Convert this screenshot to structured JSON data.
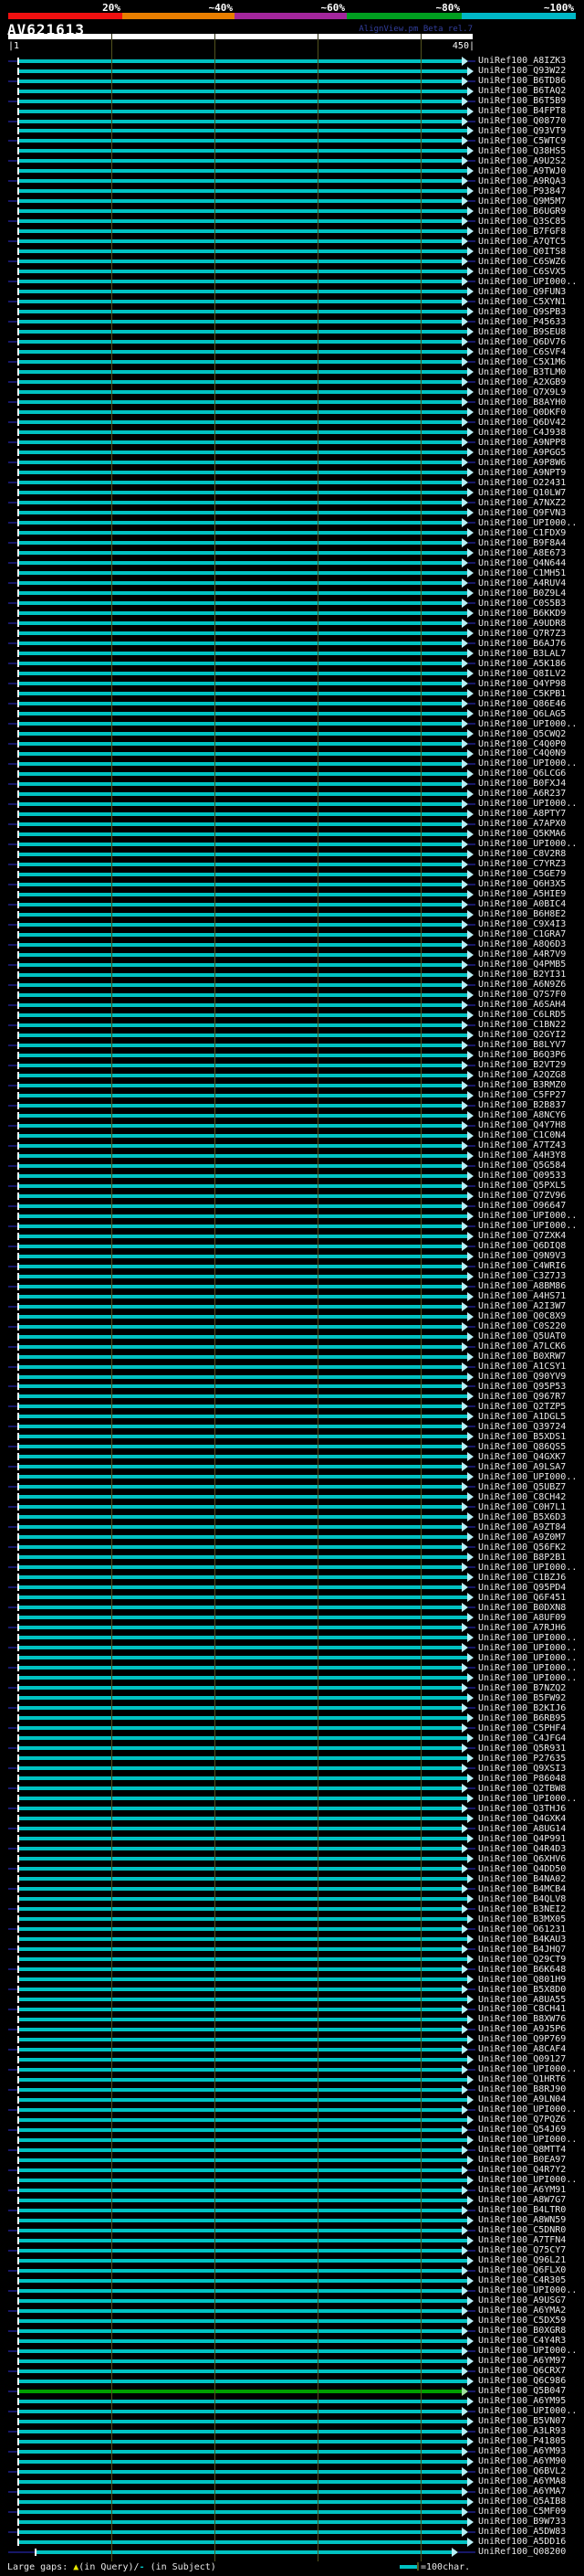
{
  "scale_bar": {
    "labels": [
      "20%",
      "~40%",
      "~60%",
      "~80%",
      "~100%"
    ],
    "colors": [
      "#f01010",
      "#e87e00",
      "#a3269c",
      "#009f20",
      "#00b7c6"
    ]
  },
  "header": {
    "query_title": "AV621613",
    "watermark": "AlignView.pm Beta rel.7",
    "ruler_start_label": "|1",
    "ruler_end_label": "450|"
  },
  "footer": {
    "gaps_prefix": "Large gaps: ",
    "gap_query_symbol": "▲",
    "gaps_mid": "(in Query)/",
    "gap_subject_symbol": "-",
    "gaps_suffix": " (in Subject)",
    "legend_label": "=100char."
  },
  "colors": {
    "alignment": "#00c2c2",
    "alignment_80pct": "#00a000",
    "subject_line": "#171768",
    "gridline": "#52521d",
    "arrow": "#b8eef5",
    "arrow_80pct": "#9fe0a0",
    "start_tick": "#ffffff",
    "label_text": "#e8e8e8"
  },
  "chart_data": {
    "type": "bar",
    "orientation": "horizontal",
    "query": "AV621613",
    "query_length": 450,
    "x_range": [
      1,
      450
    ],
    "grid_positions": [
      100,
      200,
      300,
      400
    ],
    "legend_unit": "=100char.",
    "identity_bins": [
      "20%",
      "~40%",
      "~60%",
      "~80%",
      "~100%"
    ],
    "hit_span_default": [
      1,
      450
    ],
    "hit_identity_default": "~100%",
    "hit_exceptions": {
      "232": {
        "identity_bin": "~80%"
      },
      "248": {
        "span": [
          18,
          430
        ]
      }
    },
    "hit_labels": [
      "UniRef100_A8IZK3",
      "UniRef100_Q93W22",
      "UniRef100_B6TD86",
      "UniRef100_B6TAQ2",
      "UniRef100_B6T5B9",
      "UniRef100_B4FPT8",
      "UniRef100_Q08770",
      "UniRef100_Q93VT9",
      "UniRef100_C5WTC9",
      "UniRef100_Q38HS5",
      "UniRef100_A9U2S2",
      "UniRef100_A9TWJ0",
      "UniRef100_A9RQA3",
      "UniRef100_P93847",
      "UniRef100_Q9M5M7",
      "UniRef100_B6UGR9",
      "UniRef100_Q3SC85",
      "UniRef100_B7FGF8",
      "UniRef100_A7QTC5",
      "UniRef100_Q0ITS8",
      "UniRef100_C6SWZ6",
      "UniRef100_C6SVX5",
      "UniRef100_UPI000..",
      "UniRef100_Q9FUN3",
      "UniRef100_C5XYN1",
      "UniRef100_Q9SPB3",
      "UniRef100_P45633",
      "UniRef100_B9SEU8",
      "UniRef100_Q6DV76",
      "UniRef100_C6SVF4",
      "UniRef100_C5X1M6",
      "UniRef100_B3TLM0",
      "UniRef100_A2XGB9",
      "UniRef100_Q7X9L9",
      "UniRef100_B8AYH0",
      "UniRef100_Q0DKF0",
      "UniRef100_Q6DV42",
      "UniRef100_C4J938",
      "UniRef100_A9NPP8",
      "UniRef100_A9PGG5",
      "UniRef100_A9P8W6",
      "UniRef100_A9NPT9",
      "UniRef100_O22431",
      "UniRef100_Q10LW7",
      "UniRef100_A7NXZ2",
      "UniRef100_Q9FVN3",
      "UniRef100_UPI000..",
      "UniRef100_C1FDX9",
      "UniRef100_B9F8A4",
      "UniRef100_A8E673",
      "UniRef100_Q4N644",
      "UniRef100_C1MH51",
      "UniRef100_A4RUV4",
      "UniRef100_B0Z9L4",
      "UniRef100_C0S5B3",
      "UniRef100_B6KKD9",
      "UniRef100_A9UDR8",
      "UniRef100_Q7R7Z3",
      "UniRef100_B6AJ76",
      "UniRef100_B3LAL7",
      "UniRef100_A5K186",
      "UniRef100_Q8ILV2",
      "UniRef100_Q4YP98",
      "UniRef100_C5KPB1",
      "UniRef100_Q86E46",
      "UniRef100_Q6LAG5",
      "UniRef100_UPI000..",
      "UniRef100_Q5CWQ2",
      "UniRef100_C4Q0P0",
      "UniRef100_C4Q0N9",
      "UniRef100_UPI000..",
      "UniRef100_Q6LCG6",
      "UniRef100_B0FXJ4",
      "UniRef100_A6R237",
      "UniRef100_UPI000..",
      "UniRef100_A8PTY7",
      "UniRef100_A7APX0",
      "UniRef100_Q5KMA6",
      "UniRef100_UPI000..",
      "UniRef100_C8V2R8",
      "UniRef100_C7YRZ3",
      "UniRef100_C5GE79",
      "UniRef100_Q6H3X5",
      "UniRef100_A5HIE9",
      "UniRef100_A0BIC4",
      "UniRef100_B6H8E2",
      "UniRef100_C9X4I3",
      "UniRef100_C1GRA7",
      "UniRef100_A8Q6D3",
      "UniRef100_A4R7V9",
      "UniRef100_Q4PMB5",
      "UniRef100_B2YI31",
      "UniRef100_A6N9Z6",
      "UniRef100_Q7S7F0",
      "UniRef100_A6SAH4",
      "UniRef100_C6LRD5",
      "UniRef100_C1BN22",
      "UniRef100_Q2GYI2",
      "UniRef100_B8LYV7",
      "UniRef100_B6Q3P6",
      "UniRef100_B2VT29",
      "UniRef100_A2QZG8",
      "UniRef100_B3RMZ0",
      "UniRef100_C5FP27",
      "UniRef100_B2B837",
      "UniRef100_A8NCY6",
      "UniRef100_Q4Y7H8",
      "UniRef100_C1C0N4",
      "UniRef100_A7TZ43",
      "UniRef100_A4H3Y8",
      "UniRef100_Q5G584",
      "UniRef100_Q09533",
      "UniRef100_Q5PXL5",
      "UniRef100_Q7ZV96",
      "UniRef100_O96647",
      "UniRef100_UPI000..",
      "UniRef100_UPI000..",
      "UniRef100_Q7ZXK4",
      "UniRef100_Q6DIQ8",
      "UniRef100_Q9N9V3",
      "UniRef100_C4WRI6",
      "UniRef100_C3Z7J3",
      "UniRef100_A8BM86",
      "UniRef100_A4HS71",
      "UniRef100_A2I3W7",
      "UniRef100_Q0C8X9",
      "UniRef100_C0S220",
      "UniRef100_Q5UAT0",
      "UniRef100_A7LCK6",
      "UniRef100_B0XRW7",
      "UniRef100_A1CSY1",
      "UniRef100_Q90YV9",
      "UniRef100_Q95P53",
      "UniRef100_Q967R7",
      "UniRef100_Q2TZP5",
      "UniRef100_A1DGL5",
      "UniRef100_Q39724",
      "UniRef100_B5XDS1",
      "UniRef100_Q86QS5",
      "UniRef100_Q4GXK7",
      "UniRef100_A9LSA7",
      "UniRef100_UPI000..",
      "UniRef100_Q5UBZ7",
      "UniRef100_C8CH42",
      "UniRef100_C0H7L1",
      "UniRef100_B5X6D3",
      "UniRef100_A9ZT84",
      "UniRef100_A9Z0M7",
      "UniRef100_Q56FK2",
      "UniRef100_B8P2B1",
      "UniRef100_UPI000..",
      "UniRef100_C1BZJ6",
      "UniRef100_Q95PD4",
      "UniRef100_Q6F451",
      "UniRef100_B0DXN8",
      "UniRef100_A8UF09",
      "UniRef100_A7RJH6",
      "UniRef100_UPI000..",
      "UniRef100_UPI000..",
      "UniRef100_UPI000..",
      "UniRef100_UPI000..",
      "UniRef100_UPI000..",
      "UniRef100_B7NZQ2",
      "UniRef100_B5FW92",
      "UniRef100_B2KIJ6",
      "UniRef100_B6RB95",
      "UniRef100_C5PHF4",
      "UniRef100_C4JFG4",
      "UniRef100_Q5R931",
      "UniRef100_P27635",
      "UniRef100_Q9XSI3",
      "UniRef100_P86048",
      "UniRef100_Q2TBW8",
      "UniRef100_UPI000..",
      "UniRef100_Q3THJ6",
      "UniRef100_Q4GXK4",
      "UniRef100_A8UG14",
      "UniRef100_Q4P991",
      "UniRef100_Q4R4D3",
      "UniRef100_Q6XHV6",
      "UniRef100_Q4DD50",
      "UniRef100_B4NA02",
      "UniRef100_B4MCB4",
      "UniRef100_B4QLV8",
      "UniRef100_B3NEI2",
      "UniRef100_B3MX05",
      "UniRef100_O61231",
      "UniRef100_B4KAU3",
      "UniRef100_B4JHQ7",
      "UniRef100_Q29CT9",
      "UniRef100_B6K648",
      "UniRef100_Q801H9",
      "UniRef100_B5X8D0",
      "UniRef100_A8UA55",
      "UniRef100_C8CH41",
      "UniRef100_B8XW76",
      "UniRef100_A9J5P6",
      "UniRef100_Q9P769",
      "UniRef100_A8CAF4",
      "UniRef100_Q09127",
      "UniRef100_UPI000..",
      "UniRef100_Q1HRT6",
      "UniRef100_B8RJ90",
      "UniRef100_A9LN04",
      "UniRef100_UPI000..",
      "UniRef100_Q7PQZ6",
      "UniRef100_Q54J69",
      "UniRef100_UPI000..",
      "UniRef100_Q8MTT4",
      "UniRef100_B0EA97",
      "UniRef100_Q4R7Y2",
      "UniRef100_UPI000..",
      "UniRef100_A6YM91",
      "UniRef100_A8W7G7",
      "UniRef100_B4LTR0",
      "UniRef100_A8WN59",
      "UniRef100_C5DNR0",
      "UniRef100_A7TFN4",
      "UniRef100_Q75CY7",
      "UniRef100_Q96L21",
      "UniRef100_Q6FLX0",
      "UniRef100_C4R305",
      "UniRef100_UPI000..",
      "UniRef100_A9USG7",
      "UniRef100_A6YMA2",
      "UniRef100_C5DX59",
      "UniRef100_B0XGR8",
      "UniRef100_C4Y4R3",
      "UniRef100_UPI000..",
      "UniRef100_A6YM97",
      "UniRef100_Q6CRX7",
      "UniRef100_Q6C986",
      "UniRef100_Q5B047",
      "UniRef100_A6YM95",
      "UniRef100_UPI000..",
      "UniRef100_B5VN07",
      "UniRef100_A3LR93",
      "UniRef100_P41805",
      "UniRef100_A6YM93",
      "UniRef100_A6YM90",
      "UniRef100_Q6BVL2",
      "UniRef100_A6YMA8",
      "UniRef100_A6YMA7",
      "UniRef100_Q5AIB8",
      "UniRef100_C5MF09",
      "UniRef100_B9W733",
      "UniRef100_A5DW83",
      "UniRef100_A5DD16",
      "UniRef100_Q08200"
    ]
  }
}
